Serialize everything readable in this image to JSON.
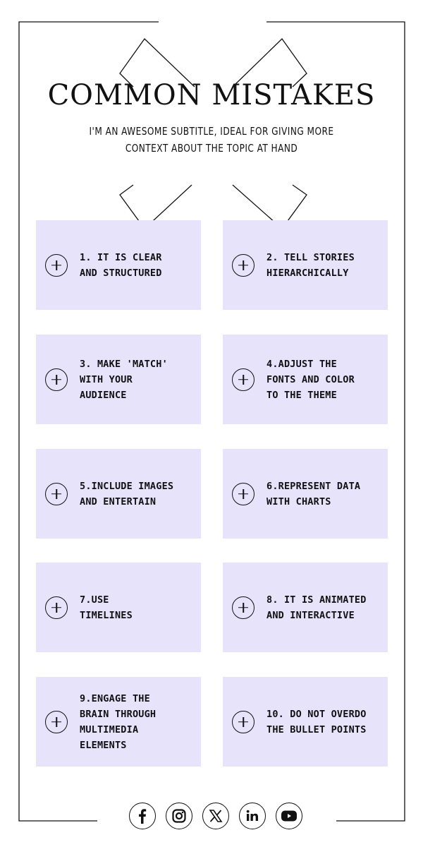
{
  "header": {
    "title": "COMMON MISTAKES",
    "subtitle_line1": "I'M AN AWESOME SUBTITLE, IDEAL FOR GIVING MORE",
    "subtitle_line2": "CONTEXT ABOUT THE TOPIC AT HAND"
  },
  "colors": {
    "card_background": "#e6e3fb",
    "ink": "#111111",
    "page_background": "#ffffff"
  },
  "cards": [
    {
      "label": "1. IT IS CLEAR\nAND STRUCTURED",
      "icon": "plus-circle-icon"
    },
    {
      "label": "2. TELL STORIES\nHIERARCHICALLY",
      "icon": "plus-circle-icon"
    },
    {
      "label": "3. MAKE 'MATCH'\nWITH YOUR\nAUDIENCE",
      "icon": "plus-circle-icon"
    },
    {
      "label": "4.ADJUST THE\nFONTS AND COLOR\nTO THE THEME",
      "icon": "plus-circle-icon"
    },
    {
      "label": "5.INCLUDE IMAGES\nAND ENTERTAIN",
      "icon": "plus-circle-icon"
    },
    {
      "label": "6.REPRESENT DATA\nWITH CHARTS",
      "icon": "plus-circle-icon"
    },
    {
      "label": "7.USE\nTIMELINES",
      "icon": "plus-circle-icon"
    },
    {
      "label": "8. IT IS ANIMATED\nAND INTERACTIVE",
      "icon": "plus-circle-icon"
    },
    {
      "label": "9.ENGAGE THE\nBRAIN THROUGH\nMULTIMEDIA\nELEMENTS",
      "icon": "plus-circle-icon"
    },
    {
      "label": "10. DO NOT OVERDO\nTHE BULLET POINTS",
      "icon": "plus-circle-icon"
    }
  ],
  "social": [
    {
      "name": "facebook-icon"
    },
    {
      "name": "instagram-icon"
    },
    {
      "name": "x-icon"
    },
    {
      "name": "linkedin-icon"
    },
    {
      "name": "youtube-icon"
    }
  ]
}
